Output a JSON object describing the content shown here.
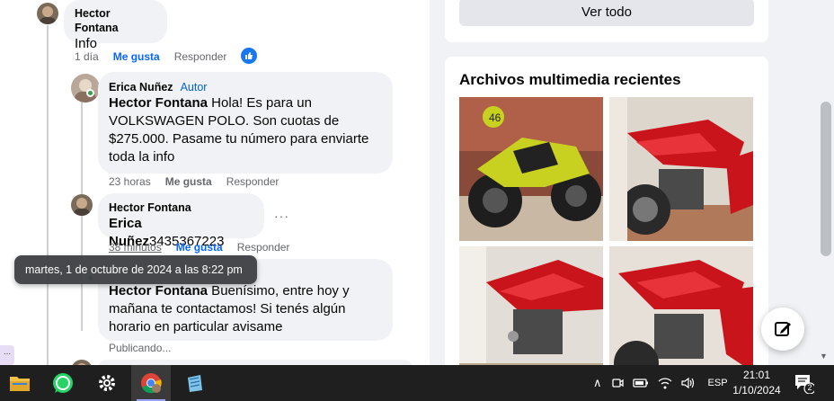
{
  "comments": [
    {
      "author": "Hector Fontana",
      "text": "Info",
      "time": "1 día",
      "like_label": "Me gusta",
      "reply_label": "Responder",
      "reaction": "like"
    },
    {
      "author": "Erica Nuñez",
      "author_tag": "Autor",
      "mention": "Hector Fontana",
      "text_lines": [
        " Hola! Es para un",
        "VOLKSWAGEN POLO. Son cuotas de",
        "$275.000. Pasame tu número para enviarte",
        "toda la info"
      ],
      "time": "23 horas",
      "like_label": "Me gusta",
      "reply_label": "Responder"
    },
    {
      "author": "Hector Fontana",
      "mention": "Erica Nuñez",
      "text": "3435367223",
      "time": "38 minutos",
      "like_label": "Me gusta",
      "reply_label": "Responder",
      "more_label": "···"
    },
    {
      "mention": "Hector Fontana",
      "text_lines": [
        " Buenísimo, entre hoy y",
        "mañana te contactamos! Si tenés algún",
        "horario en particular avisame"
      ],
      "status": "Publicando..."
    }
  ],
  "tooltip": "martes, 1 de octubre de 2024 a las 8:22 pm",
  "sidebar": {
    "see_all": "Ver todo",
    "media_title": "Archivos multimedia recientes"
  },
  "left_tab_label": "...",
  "taskbar": {
    "apps": [
      "file-explorer",
      "whatsapp",
      "settings",
      "chrome",
      "notepad"
    ],
    "language": "ESP",
    "time": "21:01",
    "date": "1/10/2024",
    "notification_count": "2"
  },
  "colors": {
    "accent": "#0866ff",
    "bubble": "#f0f2f5",
    "taskbar": "#1f1f1f"
  }
}
